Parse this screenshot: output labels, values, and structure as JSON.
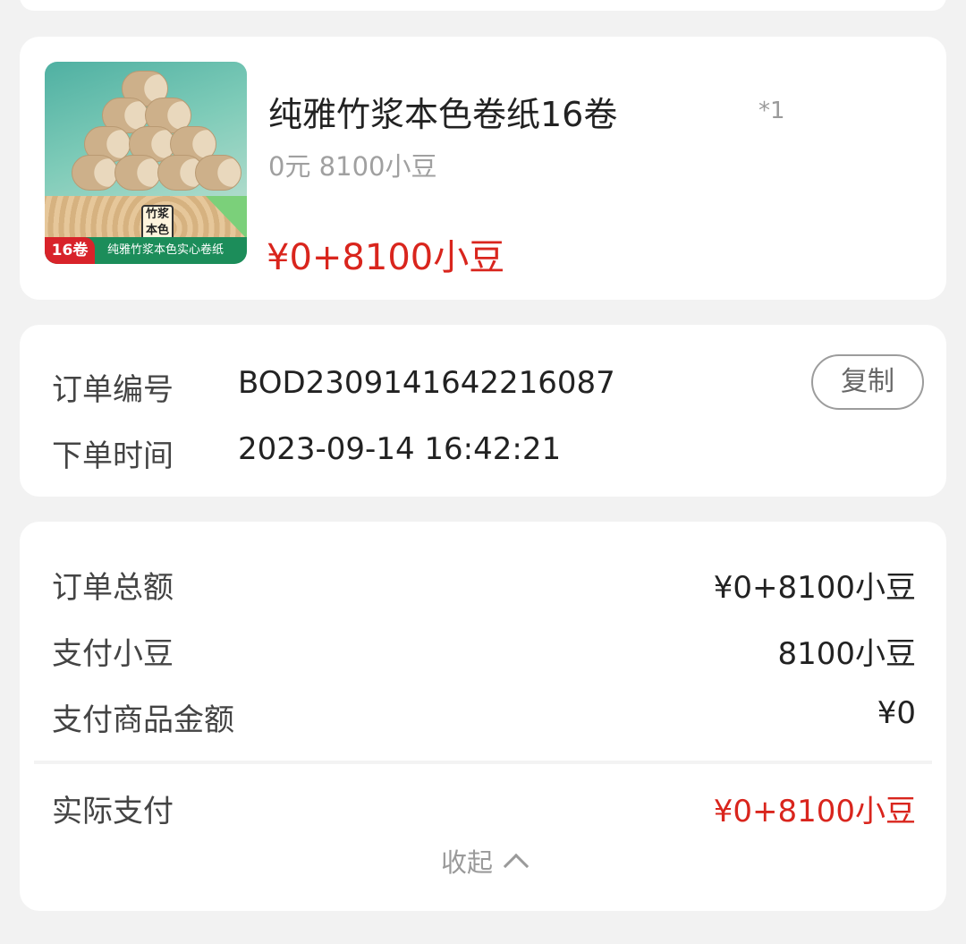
{
  "product": {
    "image_badge": "16卷",
    "image_banner": "纯雅竹浆本色实心卷纸",
    "image_pack_label": "竹浆本色",
    "title": "纯雅竹浆本色卷纸16卷",
    "quantity": "*1",
    "subtitle": "0元 8100小豆",
    "price": "¥0+8100小豆"
  },
  "order": {
    "number_label": "订单编号",
    "number_value": "BOD2309141642216087",
    "copy_label": "复制",
    "time_label": "下单时间",
    "time_value": "2023-09-14 16:42:21"
  },
  "amounts": {
    "total_label": "订单总额",
    "total_value": "¥0+8100小豆",
    "beans_label": "支付小豆",
    "beans_value": "8100小豆",
    "goods_label": "支付商品金额",
    "goods_value": "¥0",
    "actual_label": "实际支付",
    "actual_value": "¥0+8100小豆",
    "collapse_label": "收起"
  },
  "colors": {
    "accent_red": "#d9251d",
    "background": "#f2f2f2",
    "card": "#ffffff"
  }
}
